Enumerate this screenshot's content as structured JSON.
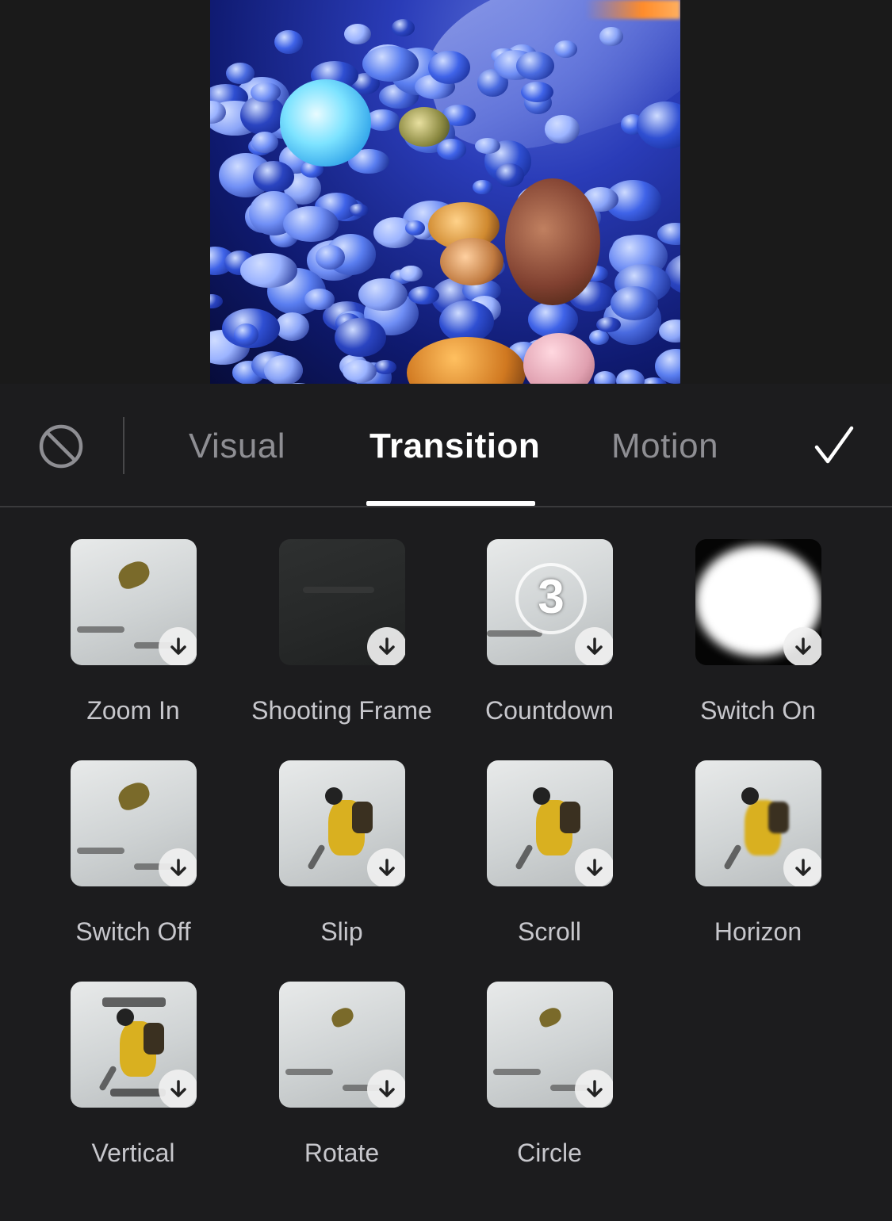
{
  "tabs": {
    "items": [
      {
        "label": "Visual",
        "active": false
      },
      {
        "label": "Transition",
        "active": true
      },
      {
        "label": "Motion",
        "active": false
      }
    ],
    "none_icon": "prohibit-icon",
    "confirm_icon": "checkmark-icon"
  },
  "transitions": [
    {
      "label": "Zoom In",
      "thumb": "bird",
      "icon": "download-icon"
    },
    {
      "label": "Shooting Frame",
      "thumb": "dark",
      "icon": "download-icon"
    },
    {
      "label": "Countdown",
      "thumb": "countdown",
      "number": "3",
      "icon": "download-icon"
    },
    {
      "label": "Switch On",
      "thumb": "white-blob",
      "icon": "download-icon"
    },
    {
      "label": "Switch Off",
      "thumb": "bird",
      "icon": "download-icon"
    },
    {
      "label": "Slip",
      "thumb": "skier",
      "icon": "download-icon"
    },
    {
      "label": "Scroll",
      "thumb": "skier",
      "icon": "download-icon"
    },
    {
      "label": "Horizon",
      "thumb": "skier-blur",
      "icon": "download-icon"
    },
    {
      "label": "Vertical",
      "thumb": "skier-glitch",
      "icon": "download-icon"
    },
    {
      "label": "Rotate",
      "thumb": "bird-small",
      "icon": "download-icon"
    },
    {
      "label": "Circle",
      "thumb": "bird-small",
      "icon": "download-icon"
    }
  ],
  "colors": {
    "background": "#1c1c1e",
    "tab_active": "#ffffff",
    "tab_inactive": "#8e8e93",
    "label": "#c7c7cc"
  }
}
